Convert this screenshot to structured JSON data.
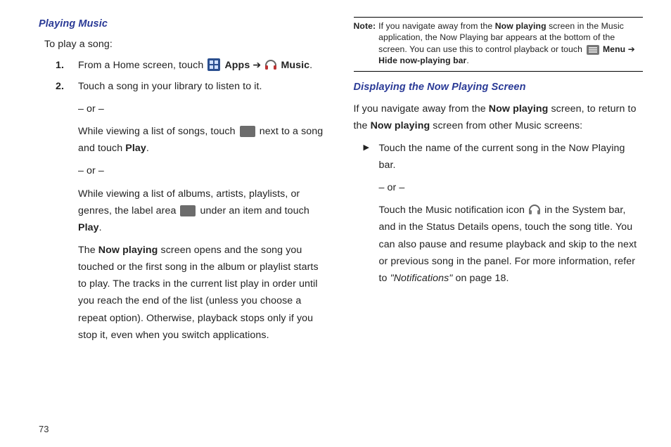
{
  "page_number": "73",
  "left": {
    "heading": "Playing Music",
    "intro": "To play a song:",
    "step1_pre": "From a Home screen, touch ",
    "step1_apps": " Apps ",
    "step1_arrow": "➔",
    "step1_music": " Music",
    "step1_end": ".",
    "step2_a": "Touch a song in your library to listen to it.",
    "or": "– or –",
    "step2_b_pre": "While viewing a list of songs, touch ",
    "step2_b_post": " next to a song and touch ",
    "play": "Play",
    "dot": ".",
    "step2_c_pre": "While viewing a list of albums, artists, playlists, or genres, the label area ",
    "step2_c_post": " under an item and touch ",
    "step2_para_pre": "The ",
    "now_playing": "Now playing",
    "step2_para_post": " screen opens and the song you touched or the first song in the album or playlist starts to play. The tracks in the current list play in order until you reach the end of the list (unless you choose a repeat option). Otherwise, playback stops only if you stop it, even when you switch applications."
  },
  "right": {
    "note_label": "Note:",
    "note_pre": "If you navigate away from the ",
    "note_np": "Now playing",
    "note_mid": " screen in the Music application, the Now Playing bar appears at the bottom of the screen. You can use this to control playback or touch ",
    "note_menu": " Menu ",
    "note_arrow": "➔",
    "note_hide": " Hide now-playing bar",
    "note_end": ".",
    "heading": "Displaying the Now Playing Screen",
    "intro_pre": "If you navigate away from the ",
    "intro_np1": "Now playing",
    "intro_mid": " screen, to return to the ",
    "intro_np2": "Now playing",
    "intro_post": " screen from other Music screens:",
    "bullet_a": "Touch the name of the current song in the Now Playing bar.",
    "or": "– or –",
    "bullet_b_pre": "Touch the Music notification icon ",
    "bullet_b_post": " in the System bar, and in the Status Details opens, touch the song title. You can also pause and resume playback and skip to the next or previous song in the panel. For more information, refer to ",
    "bullet_b_ref": "\"Notifications\"",
    "bullet_b_tail": "  on page 18."
  }
}
